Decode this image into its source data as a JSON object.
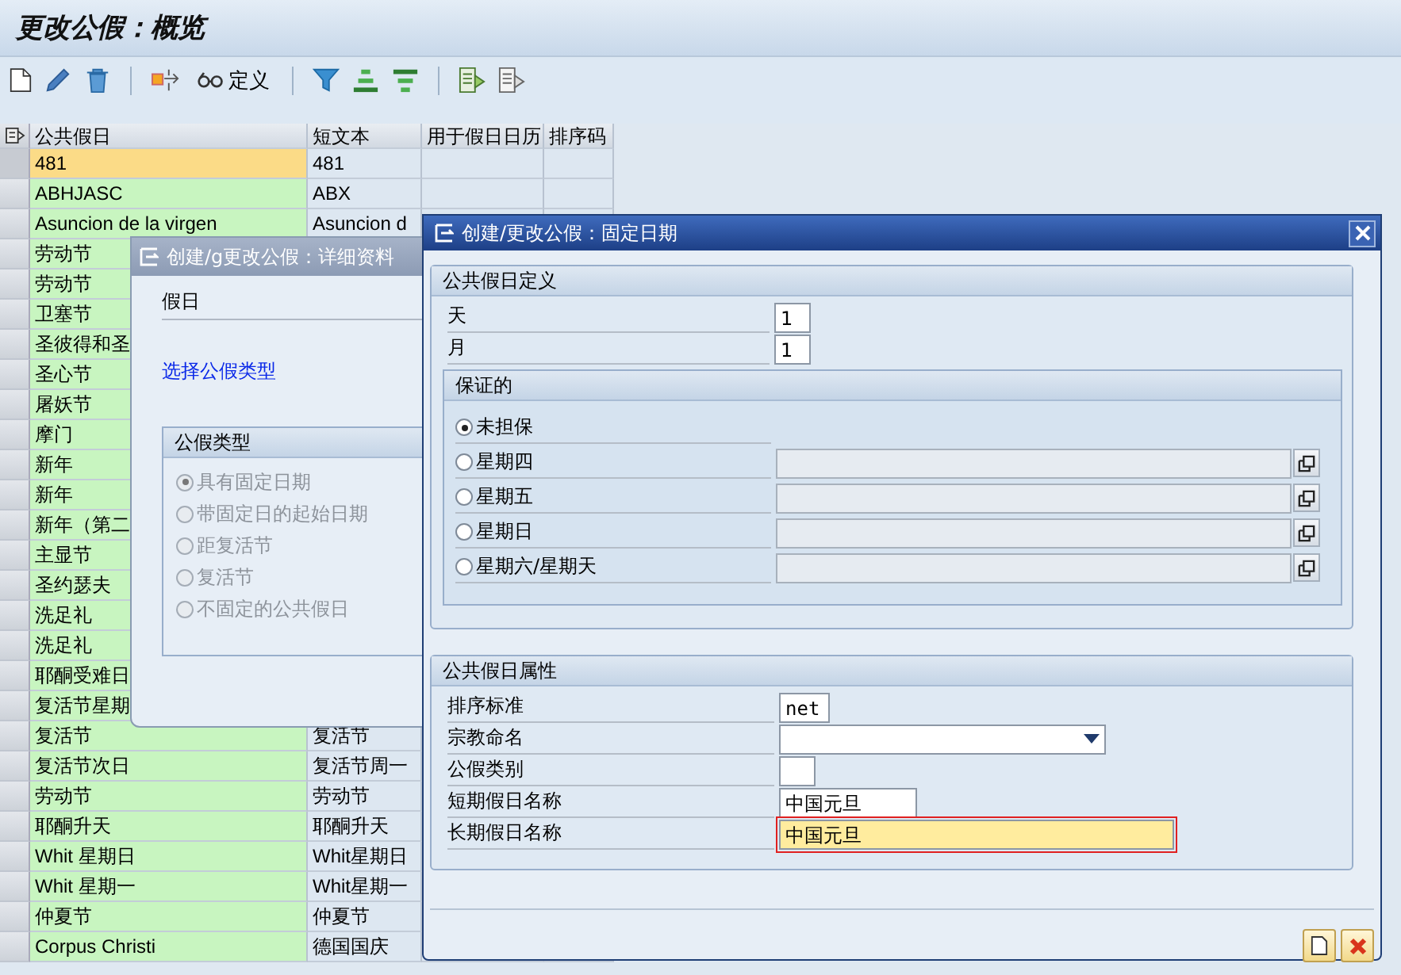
{
  "screen_title": "更改公假：概览",
  "toolbar": {
    "define_label": "定义"
  },
  "table": {
    "columns": [
      "公共假日",
      "短文本",
      "用于假日日历",
      "排序码"
    ],
    "rows": [
      {
        "selected": true,
        "holiday": "481",
        "short_text": "481"
      },
      {
        "selected": false,
        "holiday": "ABHJASC",
        "short_text": "ABX"
      },
      {
        "selected": false,
        "holiday": "Asuncion de la virgen",
        "short_text": "Asuncion d"
      },
      {
        "selected": false,
        "holiday": "劳动节"
      },
      {
        "selected": false,
        "holiday": "劳动节"
      },
      {
        "selected": false,
        "holiday": "卫塞节"
      },
      {
        "selected": false,
        "holiday": "圣彼得和圣"
      },
      {
        "selected": false,
        "holiday": "圣心节"
      },
      {
        "selected": false,
        "holiday": "屠妖节"
      },
      {
        "selected": false,
        "holiday": "摩门"
      },
      {
        "selected": false,
        "holiday": "新年"
      },
      {
        "selected": false,
        "holiday": "新年"
      },
      {
        "selected": false,
        "holiday": "新年（第二"
      },
      {
        "selected": false,
        "holiday": "主显节"
      },
      {
        "selected": false,
        "holiday": "圣约瑟夫"
      },
      {
        "selected": false,
        "holiday": "洗足礼"
      },
      {
        "selected": false,
        "holiday": "洗足礼"
      },
      {
        "selected": false,
        "holiday": "耶酮受难日"
      },
      {
        "selected": false,
        "holiday": "复活节星期"
      },
      {
        "selected": false,
        "holiday": "复活节",
        "short_text": "复活节"
      },
      {
        "selected": false,
        "holiday": "复活节次日",
        "short_text": "复活节周一"
      },
      {
        "selected": false,
        "holiday": "劳动节",
        "short_text": "劳动节"
      },
      {
        "selected": false,
        "holiday": "耶酮升天",
        "short_text": "耶酮升天"
      },
      {
        "selected": false,
        "holiday": "Whit 星期日",
        "short_text": "Whit星期日"
      },
      {
        "selected": false,
        "holiday": "Whit 星期一",
        "short_text": "Whit星期一"
      },
      {
        "selected": false,
        "holiday": "仲夏节",
        "short_text": "仲夏节"
      },
      {
        "selected": false,
        "holiday": "Corpus Christi",
        "short_text": "德国国庆"
      }
    ]
  },
  "detail_dialog": {
    "title": "创建/g更改公假：详细资料",
    "holiday_label": "假日",
    "link": "选择公假类型",
    "group_title": "公假类型",
    "options": [
      {
        "label": "具有固定日期",
        "selected": true,
        "disabled": true
      },
      {
        "label": "带固定日的起始日期",
        "selected": false,
        "disabled": true
      },
      {
        "label": "距复活节",
        "selected": false,
        "disabled": true
      },
      {
        "label": "复活节",
        "selected": false,
        "disabled": true
      },
      {
        "label": "不固定的公共假日",
        "selected": false,
        "disabled": true
      }
    ]
  },
  "fixed_date_dialog": {
    "title": "创建/更改公假：固定日期",
    "definition": {
      "title": "公共假日定义",
      "fields": [
        {
          "label": "天",
          "value": "1"
        },
        {
          "label": "月",
          "value": "1"
        }
      ],
      "guaranteed": {
        "title": "保证的",
        "options": [
          {
            "label": "未担保",
            "selected": true
          },
          {
            "label": "星期四",
            "selected": false,
            "field": {
              "disabled": true
            }
          },
          {
            "label": "星期五",
            "selected": false,
            "field": {
              "disabled": true
            }
          },
          {
            "label": "星期日",
            "selected": false,
            "field": {
              "disabled": true
            }
          },
          {
            "label": "星期六/星期天",
            "selected": false,
            "field": {
              "disabled": true
            }
          }
        ]
      }
    },
    "attributes": {
      "title": "公共假日属性",
      "fields": [
        {
          "label": "排序标准",
          "kind": "short",
          "value": "net",
          "focused": false
        },
        {
          "label": "宗教命名",
          "kind": "dropdown",
          "focused": false
        },
        {
          "label": "公假类别",
          "kind": "tiny",
          "focused": false
        },
        {
          "label": "短期假日名称",
          "kind": "medium",
          "value": "中国元旦",
          "focused": false
        },
        {
          "label": "长期假日名称",
          "kind": "long",
          "value": "中国元旦",
          "focused": true
        }
      ]
    }
  }
}
